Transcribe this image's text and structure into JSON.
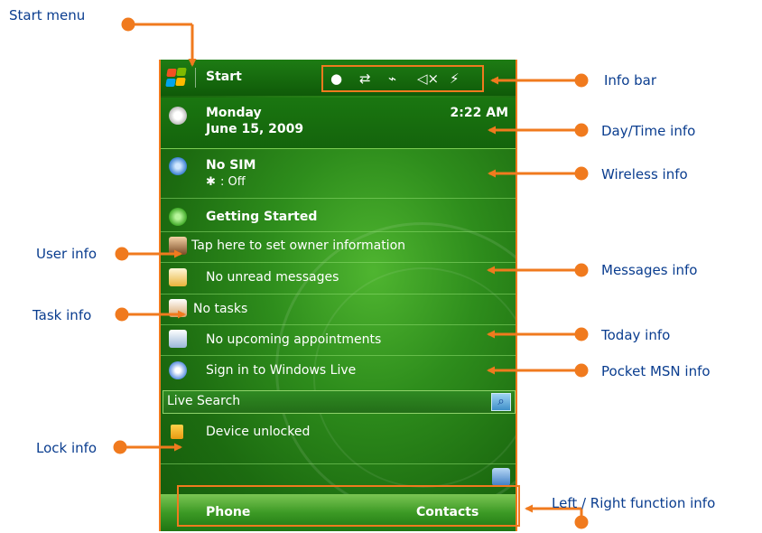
{
  "callouts": {
    "start_menu": "Start menu",
    "info_bar": "Info bar",
    "day_time": "Day/Time info",
    "wireless": "Wireless info",
    "user": "User info",
    "messages": "Messages info",
    "task": "Task info",
    "today": "Today info",
    "pocket_msn": "Pocket MSN info",
    "lock": "Lock info",
    "function": "Left / Right function info"
  },
  "titlebar": {
    "start_label": "Start",
    "icons": [
      "circle-icon",
      "sync-arrows-icon",
      "signal-off-icon",
      "speaker-mute-icon",
      "battery-charge-icon"
    ]
  },
  "today": {
    "day": "Monday",
    "date": "June 15, 2009",
    "time": "2:22 AM",
    "wireless_title": "No SIM",
    "bluetooth_status": ": Off",
    "getting_started": "Getting Started",
    "owner": "Tap here to set owner information",
    "messages": "No unread messages",
    "tasks": "No tasks",
    "appointments": "No upcoming appointments",
    "windows_live": "Sign in to Windows Live",
    "search": "Live Search",
    "lock": "Device unlocked"
  },
  "softkeys": {
    "left": "Phone",
    "right": "Contacts"
  },
  "colors": {
    "accent": "#f07a1e",
    "callout_text": "#0a3d8f",
    "screen_green": "#2e8d1c"
  }
}
